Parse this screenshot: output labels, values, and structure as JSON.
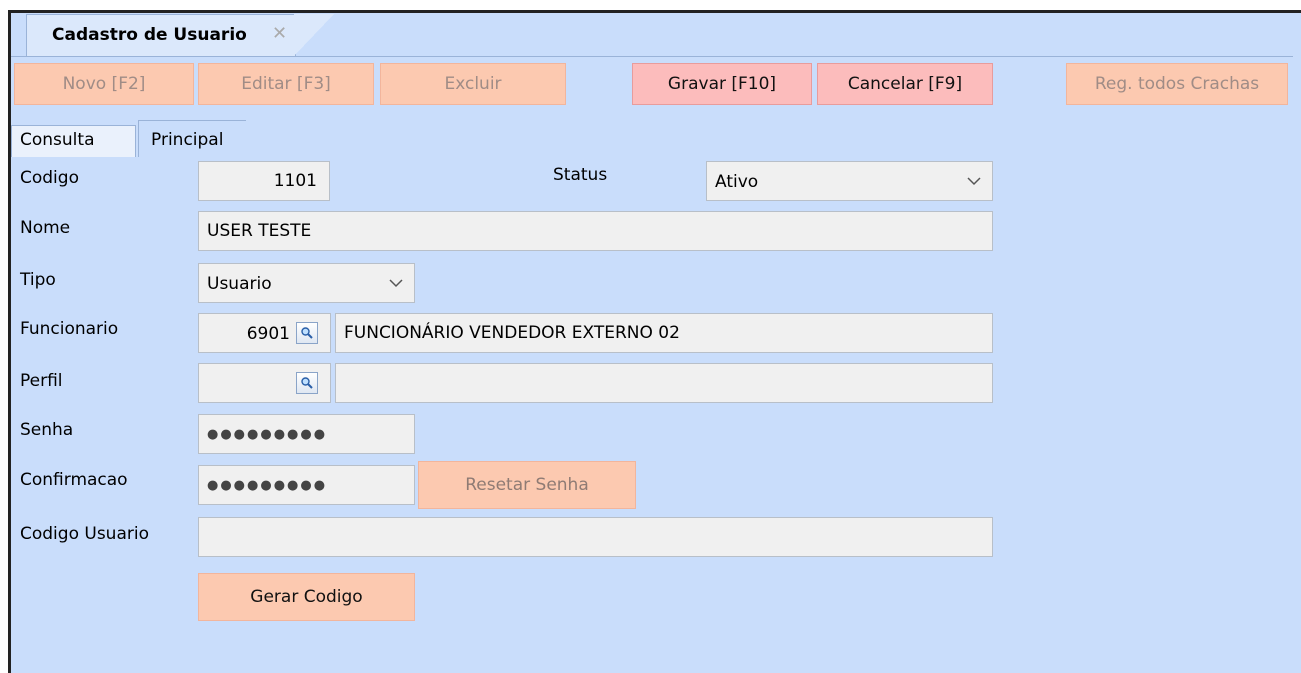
{
  "doc_tab": {
    "title": "Cadastro de Usuario",
    "close": "✕"
  },
  "toolbar": {
    "novo": "Novo [F2]",
    "editar": "Editar [F3]",
    "excluir": "Excluir",
    "gravar": "Gravar [F10]",
    "cancelar": "Cancelar [F9]",
    "reg_crachas": "Reg. todos Crachas"
  },
  "tabs": {
    "consulta": "Consulta",
    "principal": "Principal"
  },
  "form": {
    "codigo_label": "Codigo",
    "codigo_value": "1101",
    "status_label": "Status",
    "status_value": "Ativo",
    "nome_label": "Nome",
    "nome_value": "USER TESTE",
    "tipo_label": "Tipo",
    "tipo_value": "Usuario",
    "funcionario_label": "Funcionario",
    "funcionario_code": "6901",
    "funcionario_name": "FUNCIONÁRIO VENDEDOR EXTERNO 02",
    "perfil_label": "Perfil",
    "perfil_code": "",
    "perfil_name": "",
    "senha_label": "Senha",
    "senha_value": "●●●●●●●●●",
    "confirmacao_label": "Confirmacao",
    "confirmacao_value": "●●●●●●●●●",
    "resetar_senha": "Resetar Senha",
    "codigo_usuario_label": "Codigo Usuario",
    "codigo_usuario_value": "",
    "gerar_codigo": "Gerar Codigo"
  },
  "colors": {
    "background": "#c9ddfb",
    "disabled_button": "#fcc9b0",
    "active_button": "#fcbcbc"
  }
}
